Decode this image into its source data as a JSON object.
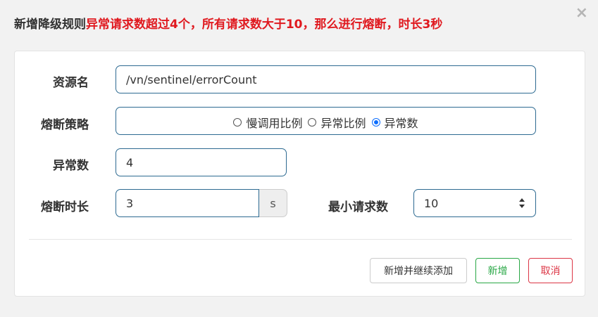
{
  "dialog": {
    "title": "新增降级规则",
    "title_note": "异常请求数超过4个，所有请求数大于10，那么进行熔断，时长3秒",
    "close_glyph": "×"
  },
  "form": {
    "resource": {
      "label": "资源名",
      "value": "/vn/sentinel/errorCount"
    },
    "strategy": {
      "label": "熔断策略",
      "options": [
        {
          "label": "慢调用比例",
          "checked": false
        },
        {
          "label": "异常比例",
          "checked": false
        },
        {
          "label": "异常数",
          "checked": true
        }
      ]
    },
    "error_count": {
      "label": "异常数",
      "value": "4"
    },
    "duration": {
      "label": "熔断时长",
      "value": "3",
      "unit": "s"
    },
    "min_requests": {
      "label": "最小请求数",
      "value": "10"
    }
  },
  "buttons": {
    "save_continue": "新增并继续添加",
    "add": "新增",
    "cancel": "取消"
  },
  "colors": {
    "title_note": "#e0191f",
    "input_border": "#2d6a91",
    "radio_checked": "#0d6efd",
    "add_button": "#28a745",
    "cancel_button": "#dc3545"
  }
}
